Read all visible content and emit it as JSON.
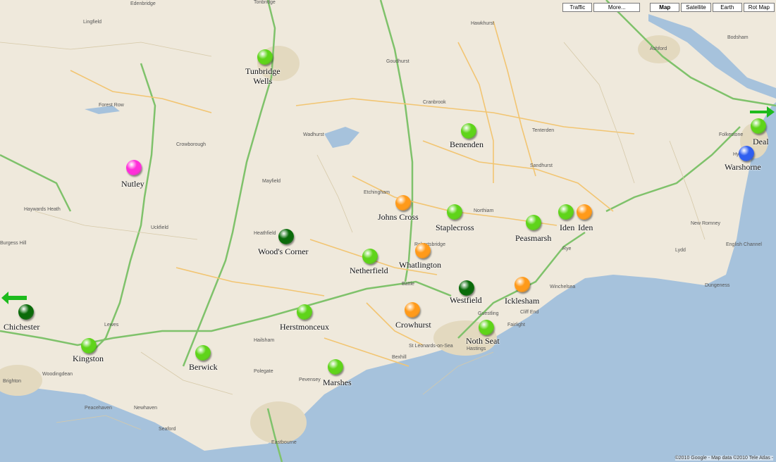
{
  "toolbar": {
    "traffic": "Traffic",
    "more": "More...",
    "map": "Map",
    "satellite": "Satellite",
    "earth": "Earth",
    "rotmap": "Rot Map"
  },
  "colors": {
    "land": "#efe9dc",
    "sea": "#a6c2dc",
    "road_major": "#7fc26b",
    "road_minor": "#f2c572",
    "green_marker": "#5fd41a",
    "dark_green_marker": "#0a6b0a",
    "orange_marker": "#ff9a1a",
    "blue_marker": "#2f5ff0",
    "magenta_marker": "#ff2fd9"
  },
  "markers": [
    {
      "name": "Tunbridge Wells",
      "label": "Tunbridge\nWells",
      "color": "green"
    },
    {
      "name": "Nutley",
      "label": "Nutley",
      "color": "magenta"
    },
    {
      "name": "Benenden",
      "label": "Benenden",
      "color": "green"
    },
    {
      "name": "Deal",
      "label": "Deal",
      "color": "green"
    },
    {
      "name": "Warshorne",
      "label": "Warshorne",
      "color": "blue"
    },
    {
      "name": "Johns Cross",
      "label": "Johns Cross",
      "color": "orange"
    },
    {
      "name": "Staplecross",
      "label": "Staplecross",
      "color": "green"
    },
    {
      "name": "Peasmarsh",
      "label": "Peasmarsh",
      "color": "green"
    },
    {
      "name": "Iden green",
      "label": "Iden",
      "color": "green"
    },
    {
      "name": "Iden orange",
      "label": "Iden",
      "color": "orange"
    },
    {
      "name": "Wood's Corner",
      "label": "Wood's Corner",
      "color": "darkgreen"
    },
    {
      "name": "Netherfield",
      "label": "Netherfield",
      "color": "green"
    },
    {
      "name": "Whatlington",
      "label": "Whatlington",
      "color": "orange"
    },
    {
      "name": "Westfield",
      "label": "Westfield",
      "color": "darkgreen"
    },
    {
      "name": "Icklesham",
      "label": "Icklesham",
      "color": "orange"
    },
    {
      "name": "Chichester",
      "label": "Chichester",
      "color": "darkgreen"
    },
    {
      "name": "Herstmonceux",
      "label": "Herstmonceux",
      "color": "green"
    },
    {
      "name": "Crowhurst",
      "label": "Crowhurst",
      "color": "orange"
    },
    {
      "name": "Noth Seat",
      "label": "Noth Seat",
      "color": "green"
    },
    {
      "name": "Kingston",
      "label": "Kingston",
      "color": "green"
    },
    {
      "name": "Berwick",
      "label": "Berwick",
      "color": "green"
    },
    {
      "name": "Marshes",
      "label": "Marshes",
      "color": "green"
    }
  ],
  "towns": [
    "Edenbridge",
    "Tonbridge",
    "Ashford",
    "Bodsham",
    "Lingfield",
    "Forest Row",
    "Crowborough",
    "Heathfield",
    "Mayfield",
    "Etchingham",
    "Cranbrook",
    "Tenterden",
    "Rye",
    "Lydd",
    "Dungeness",
    "New Romney",
    "Battle",
    "Hastings",
    "St Leonards-on-Sea",
    "Bexhill",
    "Pevensey",
    "Eastbourne",
    "Polegate",
    "Hailsham",
    "Lewes",
    "Newhaven",
    "Seaford",
    "Peacehaven",
    "Brighton",
    "Burgess Hill",
    "Haywards Heath",
    "Uckfield",
    "Hawkhurst",
    "Goudhurst",
    "Wadhurst",
    "Hythe",
    "Folkestone",
    "English Channel",
    "Winchelsea",
    "Fairlight",
    "Northiam",
    "Robertsbridge",
    "Sandhurst",
    "Woodingdean",
    "Cliff End",
    "Guestling"
  ],
  "copyright": "©2010 Google - Map data ©2010 Tele Atlas -"
}
